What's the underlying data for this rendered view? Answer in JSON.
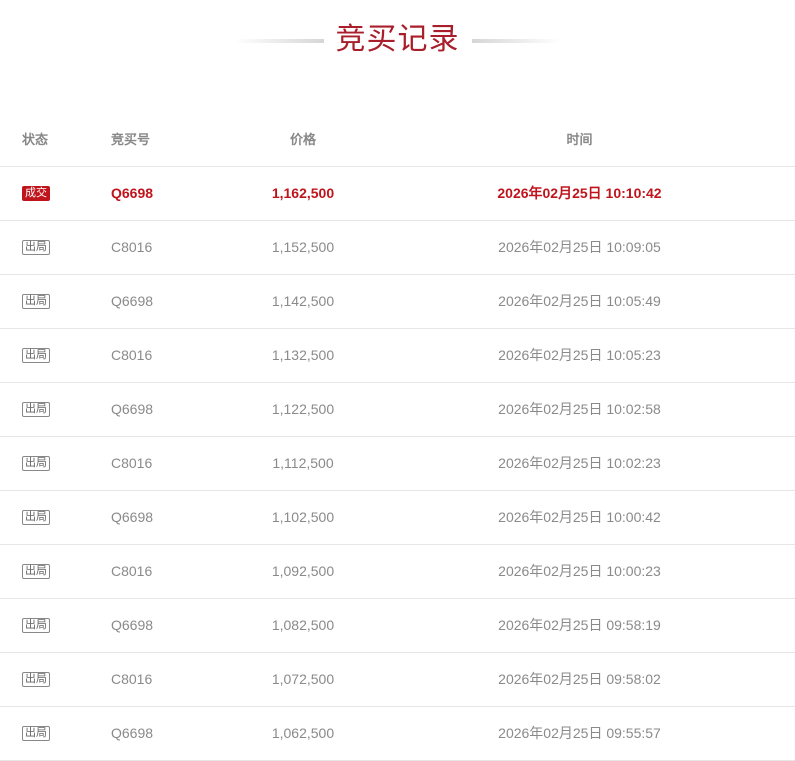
{
  "title": "竞买记录",
  "columns": {
    "status": "状态",
    "bid_no": "竞买号",
    "price": "价格",
    "time": "时间"
  },
  "rows": [
    {
      "status": "成交",
      "bid_no": "Q6698",
      "price": "1,162,500",
      "time": "2026年02月25日 10:10:42"
    },
    {
      "status": "出局",
      "bid_no": "C8016",
      "price": "1,152,500",
      "time": "2026年02月25日 10:09:05"
    },
    {
      "status": "出局",
      "bid_no": "Q6698",
      "price": "1,142,500",
      "time": "2026年02月25日 10:05:49"
    },
    {
      "status": "出局",
      "bid_no": "C8016",
      "price": "1,132,500",
      "time": "2026年02月25日 10:05:23"
    },
    {
      "status": "出局",
      "bid_no": "Q6698",
      "price": "1,122,500",
      "time": "2026年02月25日 10:02:58"
    },
    {
      "status": "出局",
      "bid_no": "C8016",
      "price": "1,112,500",
      "time": "2026年02月25日 10:02:23"
    },
    {
      "status": "出局",
      "bid_no": "Q6698",
      "price": "1,102,500",
      "time": "2026年02月25日 10:00:42"
    },
    {
      "status": "出局",
      "bid_no": "C8016",
      "price": "1,092,500",
      "time": "2026年02月25日 10:00:23"
    },
    {
      "status": "出局",
      "bid_no": "Q6698",
      "price": "1,082,500",
      "time": "2026年02月25日 09:58:19"
    },
    {
      "status": "出局",
      "bid_no": "C8016",
      "price": "1,072,500",
      "time": "2026年02月25日 09:58:02"
    },
    {
      "status": "出局",
      "bid_no": "Q6698",
      "price": "1,062,500",
      "time": "2026年02月25日 09:55:57"
    }
  ]
}
